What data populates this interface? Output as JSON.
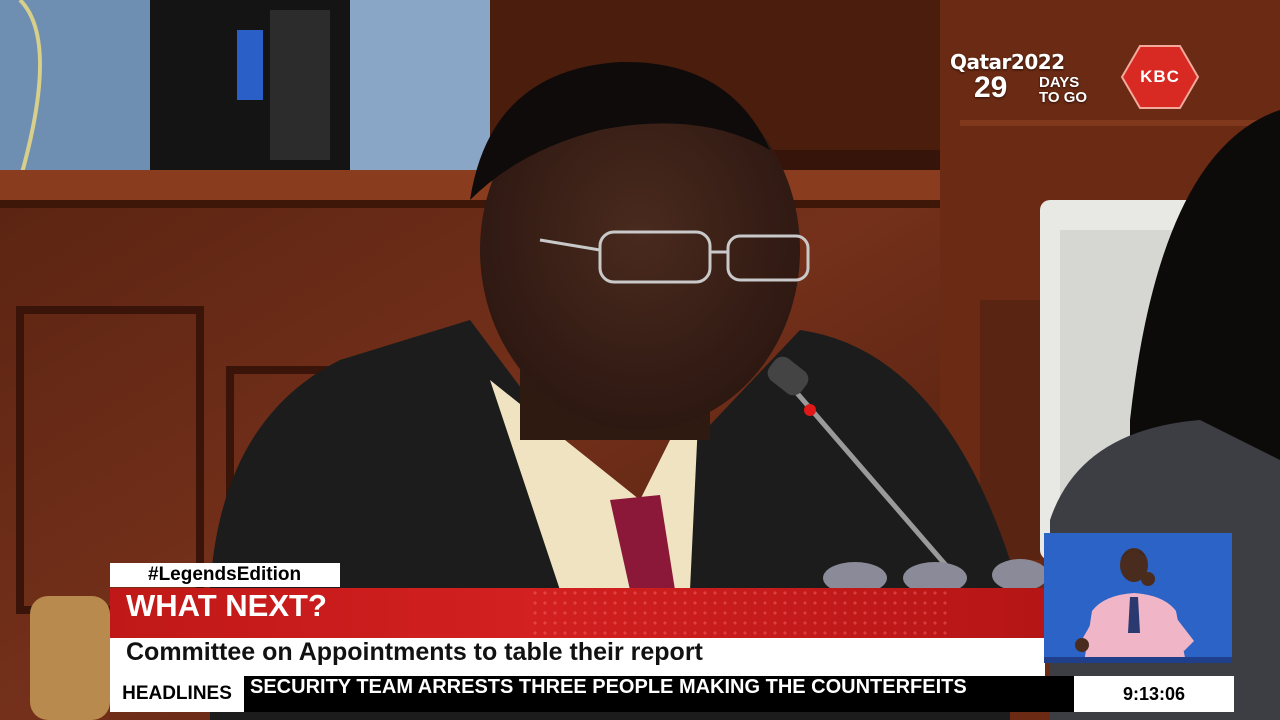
{
  "branding": {
    "event_title": "Qatar2022",
    "days_count": "29",
    "days_label": "DAYS",
    "to_go_label": "TO GO",
    "channel_logo_text": "KBC",
    "logo_color": "#d82a22"
  },
  "lower_third": {
    "hashtag": "#LegendsEdition",
    "headline": "WHAT NEXT?",
    "subheadline": "Committee on Appointments to table their report",
    "accent_color": "#c8191a"
  },
  "ticker": {
    "label": "HEADLINES",
    "text": "SECURITY TEAM ARRESTS THREE PEOPLE MAKING THE COUNTERFEITS"
  },
  "clock": {
    "time": "9:13:06"
  }
}
